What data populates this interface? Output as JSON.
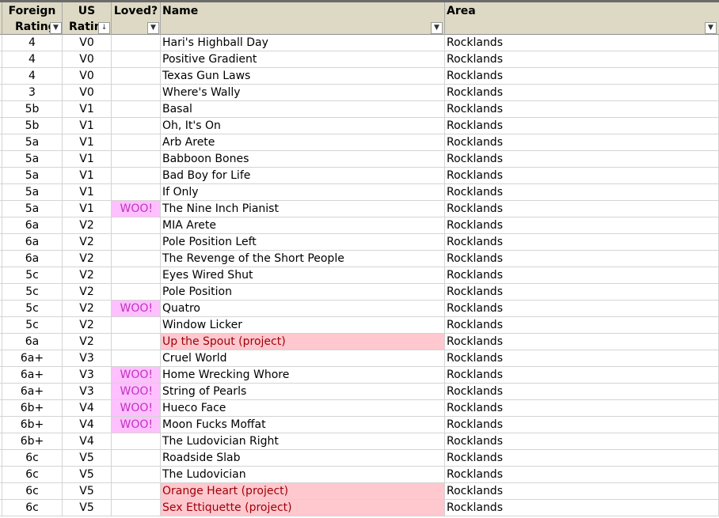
{
  "header": {
    "col_foreign_line1": "Foreign",
    "col_foreign_line2": "Rating",
    "col_us_line1": "US",
    "col_us_line2": "Ratin",
    "col_loved": "Loved?",
    "col_name": "Name",
    "col_area": "Area",
    "dropdown_glyph": "▼",
    "sorted_glyph": "↓"
  },
  "rows": [
    {
      "foreign": "4",
      "us": "V0",
      "loved": "",
      "name": "Hari's Highball Day",
      "area": "Rocklands",
      "project": false
    },
    {
      "foreign": "4",
      "us": "V0",
      "loved": "",
      "name": "Positive Gradient",
      "area": "Rocklands",
      "project": false
    },
    {
      "foreign": "4",
      "us": "V0",
      "loved": "",
      "name": "Texas Gun Laws",
      "area": "Rocklands",
      "project": false
    },
    {
      "foreign": "3",
      "us": "V0",
      "loved": "",
      "name": "Where's Wally",
      "area": "Rocklands",
      "project": false
    },
    {
      "foreign": "5b",
      "us": "V1",
      "loved": "",
      "name": "Basal",
      "area": "Rocklands",
      "project": false
    },
    {
      "foreign": "5b",
      "us": "V1",
      "loved": "",
      "name": "Oh, It's On",
      "area": "Rocklands",
      "project": false
    },
    {
      "foreign": "5a",
      "us": "V1",
      "loved": "",
      "name": "Arb Arete",
      "area": "Rocklands",
      "project": false
    },
    {
      "foreign": "5a",
      "us": "V1",
      "loved": "",
      "name": "Babboon Bones",
      "area": "Rocklands",
      "project": false
    },
    {
      "foreign": "5a",
      "us": "V1",
      "loved": "",
      "name": "Bad Boy for Life",
      "area": "Rocklands",
      "project": false
    },
    {
      "foreign": "5a",
      "us": "V1",
      "loved": "",
      "name": "If Only",
      "area": "Rocklands",
      "project": false
    },
    {
      "foreign": "5a",
      "us": "V1",
      "loved": "WOO!",
      "name": "The Nine Inch Pianist",
      "area": "Rocklands",
      "project": false
    },
    {
      "foreign": "6a",
      "us": "V2",
      "loved": "",
      "name": "MIA Arete",
      "area": "Rocklands",
      "project": false
    },
    {
      "foreign": "6a",
      "us": "V2",
      "loved": "",
      "name": "Pole Position Left",
      "area": "Rocklands",
      "project": false
    },
    {
      "foreign": "6a",
      "us": "V2",
      "loved": "",
      "name": "The Revenge of the Short People",
      "area": "Rocklands",
      "project": false
    },
    {
      "foreign": "5c",
      "us": "V2",
      "loved": "",
      "name": "Eyes Wired Shut",
      "area": "Rocklands",
      "project": false
    },
    {
      "foreign": "5c",
      "us": "V2",
      "loved": "",
      "name": "Pole Position",
      "area": "Rocklands",
      "project": false
    },
    {
      "foreign": "5c",
      "us": "V2",
      "loved": "WOO!",
      "name": "Quatro",
      "area": "Rocklands",
      "project": false
    },
    {
      "foreign": "5c",
      "us": "V2",
      "loved": "",
      "name": "Window Licker",
      "area": "Rocklands",
      "project": false
    },
    {
      "foreign": "6a",
      "us": "V2",
      "loved": "",
      "name": "Up the Spout (project)",
      "area": "Rocklands",
      "project": true
    },
    {
      "foreign": "6a+",
      "us": "V3",
      "loved": "",
      "name": "Cruel World",
      "area": "Rocklands",
      "project": false
    },
    {
      "foreign": "6a+",
      "us": "V3",
      "loved": "WOO!",
      "name": "Home Wrecking Whore",
      "area": "Rocklands",
      "project": false
    },
    {
      "foreign": "6a+",
      "us": "V3",
      "loved": "WOO!",
      "name": "String of Pearls",
      "area": "Rocklands",
      "project": false
    },
    {
      "foreign": "6b+",
      "us": "V4",
      "loved": "WOO!",
      "name": "Hueco Face",
      "area": "Rocklands",
      "project": false
    },
    {
      "foreign": "6b+",
      "us": "V4",
      "loved": "WOO!",
      "name": "Moon Fucks Moffat",
      "area": "Rocklands",
      "project": false
    },
    {
      "foreign": "6b+",
      "us": "V4",
      "loved": "",
      "name": "The Ludovician Right",
      "area": "Rocklands",
      "project": false
    },
    {
      "foreign": "6c",
      "us": "V5",
      "loved": "",
      "name": "Roadside Slab",
      "area": "Rocklands",
      "project": false
    },
    {
      "foreign": "6c",
      "us": "V5",
      "loved": "",
      "name": "The Ludovician",
      "area": "Rocklands",
      "project": false
    },
    {
      "foreign": "6c",
      "us": "V5",
      "loved": "",
      "name": "Orange Heart (project)",
      "area": "Rocklands",
      "project": true
    },
    {
      "foreign": "6c",
      "us": "V5",
      "loved": "",
      "name": "Sex Ettiquette (project)",
      "area": "Rocklands",
      "project": true
    }
  ],
  "colors": {
    "header_bg": "#ddd9c4",
    "loved_bg": "#ffc0ff",
    "loved_text": "#c130c1",
    "project_bg": "#ffc7ce",
    "project_text": "#9c0006"
  }
}
